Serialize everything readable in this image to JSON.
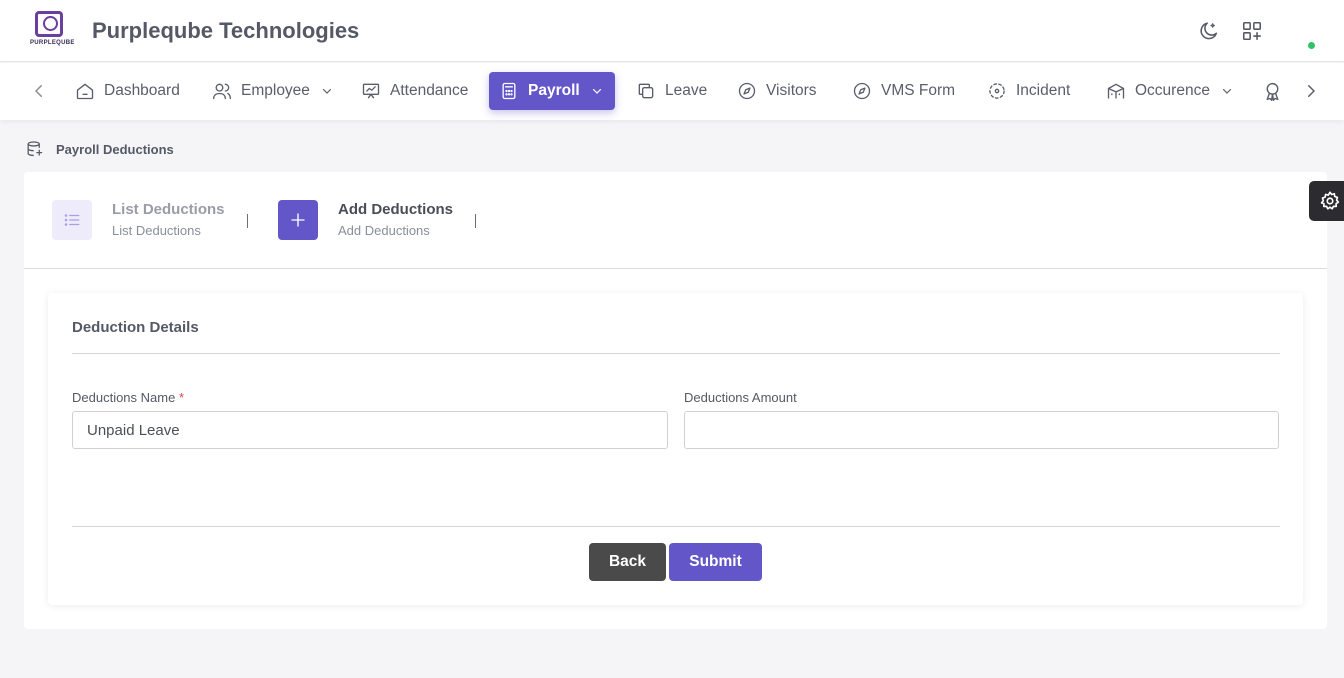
{
  "header": {
    "logo_text": "PURPLEQUBE",
    "company_name": "Purpleqube Technologies",
    "icons": [
      "moon-icon",
      "apps-add-icon"
    ],
    "status_color": "#2ec26a"
  },
  "nav": {
    "items": [
      {
        "label": "Dashboard",
        "icon": "home-icon"
      },
      {
        "label": "Employee",
        "icon": "users-icon",
        "has_dropdown": true
      },
      {
        "label": "Attendance",
        "icon": "presentation-chart-icon"
      },
      {
        "label": "Payroll",
        "icon": "calculator-icon",
        "has_dropdown": true,
        "active": true
      },
      {
        "label": "Leave",
        "icon": "copy-icon"
      },
      {
        "label": "Visitors",
        "icon": "compass-icon"
      },
      {
        "label": "VMS Form",
        "icon": "compass-icon"
      },
      {
        "label": "Incident",
        "icon": "focus-icon"
      },
      {
        "label": "Occurence",
        "icon": "building-icon",
        "has_dropdown": true
      }
    ],
    "active_color": "#6356c9"
  },
  "breadcrumb": {
    "label": "Payroll Deductions",
    "icon": "database-icon"
  },
  "tabs": [
    {
      "title": "List Deductions",
      "subtitle": "List Deductions",
      "icon": "list-icon",
      "active": false
    },
    {
      "title": "Add Deductions",
      "subtitle": "Add Deductions",
      "icon": "plus-icon",
      "active": true
    }
  ],
  "form": {
    "section_title": "Deduction Details",
    "fields": [
      {
        "label": "Deductions Name",
        "required_mark": "*",
        "value": "Unpaid Leave",
        "placeholder": ""
      },
      {
        "label": "Deductions Amount",
        "value": "",
        "placeholder": ""
      }
    ],
    "back_label": "Back",
    "submit_label": "Submit"
  }
}
